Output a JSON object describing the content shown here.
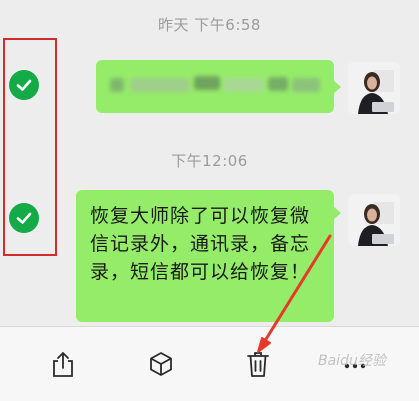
{
  "chat": {
    "timestamp_1": "昨天 下午6:58",
    "timestamp_2": "下午12:06",
    "message_2_text": "恢复大师除了可以恢复微信记录外，通讯录，备忘录，短信都可以给恢复！"
  },
  "toolbar": {
    "share_icon": "share-icon",
    "save_icon": "box-icon",
    "delete_icon": "trash-icon",
    "more_icon": "more-icon"
  },
  "watermark": "Baidu经验",
  "colors": {
    "bubble": "#95ec69",
    "check": "#13aa47",
    "highlight": "#d62b2b",
    "arrow": "#e53a2a"
  }
}
